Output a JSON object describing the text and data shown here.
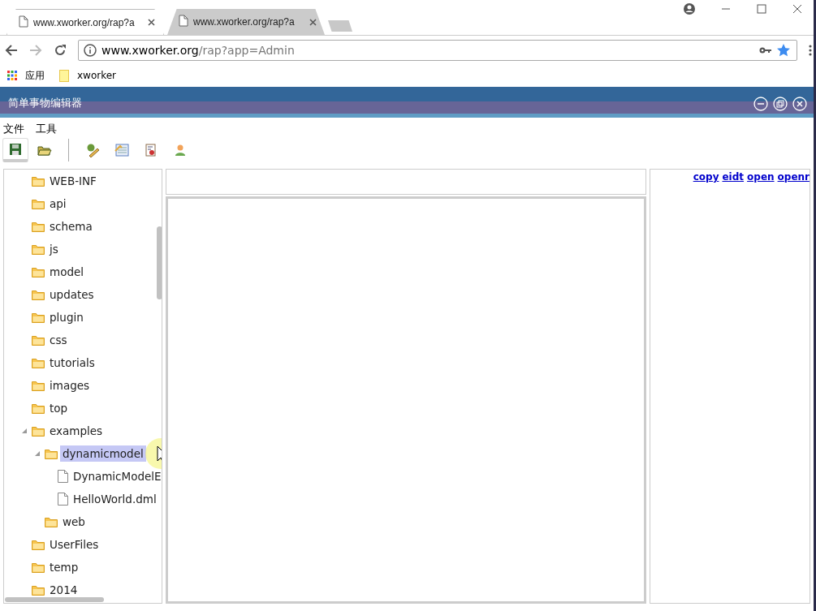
{
  "browser": {
    "tabs": [
      {
        "title": "www.xworker.org/rap?a",
        "selected": true
      },
      {
        "title": "www.xworker.org/rap?a",
        "selected": false
      }
    ],
    "address": {
      "host": "www.xworker.org",
      "path": "/rap?app=Admin"
    },
    "bookmarks": [
      {
        "label": "应用",
        "kind": "apps"
      },
      {
        "label": "xworker",
        "kind": "folder"
      }
    ]
  },
  "app": {
    "title": "简单事物编辑器",
    "menu": [
      "文件",
      "工具"
    ],
    "toolbar": [
      {
        "kind": "save",
        "pressed": true
      },
      {
        "kind": "open",
        "pressed": false
      },
      {
        "kind": "separator"
      },
      {
        "kind": "edit",
        "pressed": false
      },
      {
        "kind": "form",
        "pressed": false
      },
      {
        "kind": "document",
        "pressed": false
      },
      {
        "kind": "user",
        "pressed": false
      }
    ],
    "tree": [
      {
        "label": "WEB-INF",
        "kind": "folder",
        "expanded": false,
        "selected": false
      },
      {
        "label": "api",
        "kind": "folder",
        "expanded": false,
        "selected": false
      },
      {
        "label": "schema",
        "kind": "folder",
        "expanded": false,
        "selected": false
      },
      {
        "label": "js",
        "kind": "folder",
        "expanded": false,
        "selected": false
      },
      {
        "label": "model",
        "kind": "folder",
        "expanded": false,
        "selected": false
      },
      {
        "label": "updates",
        "kind": "folder",
        "expanded": false,
        "selected": false
      },
      {
        "label": "plugin",
        "kind": "folder",
        "expanded": false,
        "selected": false
      },
      {
        "label": "css",
        "kind": "folder",
        "expanded": false,
        "selected": false
      },
      {
        "label": "tutorials",
        "kind": "folder",
        "expanded": false,
        "selected": false
      },
      {
        "label": "images",
        "kind": "folder",
        "expanded": false,
        "selected": false
      },
      {
        "label": "top",
        "kind": "folder",
        "expanded": false,
        "selected": false
      },
      {
        "label": "examples",
        "kind": "folder",
        "expanded": true,
        "selected": false,
        "children": [
          {
            "label": "dynamicmodel",
            "kind": "folder",
            "expanded": true,
            "selected": true,
            "children": [
              {
                "label": "DynamicModelE",
                "kind": "file",
                "selected": false
              },
              {
                "label": "HelloWorld.dml",
                "kind": "file",
                "selected": false
              }
            ]
          },
          {
            "label": "web",
            "kind": "folder",
            "expanded": false,
            "selected": false
          }
        ]
      },
      {
        "label": "UserFiles",
        "kind": "folder",
        "expanded": false,
        "selected": false
      },
      {
        "label": "temp",
        "kind": "folder",
        "expanded": false,
        "selected": false
      },
      {
        "label": "2014",
        "kind": "folder",
        "expanded": false,
        "selected": false
      }
    ],
    "links": [
      "copy",
      "eidt",
      "open",
      "openr"
    ]
  }
}
